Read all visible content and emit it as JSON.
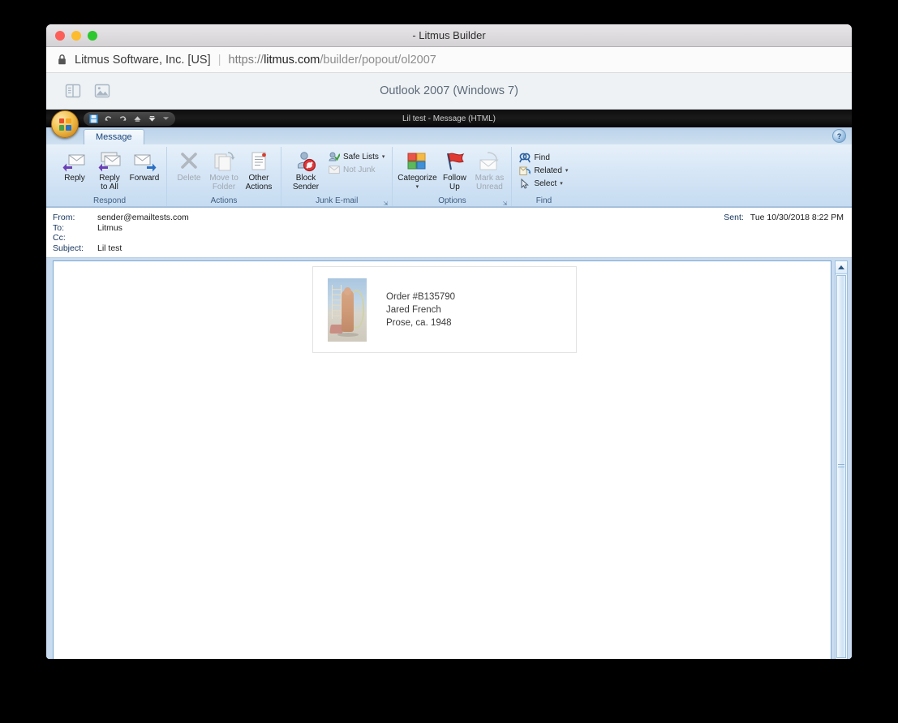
{
  "browser": {
    "title": "- Litmus Builder",
    "traffic_lights": [
      "close",
      "minimize",
      "maximize"
    ],
    "security": {
      "icon": "lock-icon",
      "owner": "Litmus Software, Inc. [US]",
      "separator": "|"
    },
    "url": {
      "scheme": "https://",
      "host": "litmus.com",
      "path": "/builder/popout/ol2007"
    }
  },
  "litmus_toolbar": {
    "icons": [
      "split-pane-icon",
      "image-icon"
    ],
    "client_name": "Outlook 2007 (Windows 7)"
  },
  "outlook": {
    "window_title": "Lil test  -  Message (HTML)",
    "office_button": "Office",
    "quick_access": [
      {
        "name": "save-icon",
        "label": "Save"
      },
      {
        "name": "undo-icon",
        "label": "Undo"
      },
      {
        "name": "redo-icon",
        "label": "Redo"
      },
      {
        "name": "previous-item-icon",
        "label": "Previous Item"
      },
      {
        "name": "next-item-icon",
        "label": "Next Item"
      },
      {
        "name": "customize-qat-icon",
        "label": "Customize Quick Access Toolbar"
      }
    ],
    "tabs": [
      {
        "label": "Message",
        "active": true
      }
    ],
    "help_label": "?",
    "ribbon_groups": [
      {
        "label": "Respond",
        "dialog_launcher": false,
        "buttons": [
          {
            "label_line1": "Reply",
            "label_line2": "",
            "icon": "reply-icon",
            "disabled": false
          },
          {
            "label_line1": "Reply",
            "label_line2": "to All",
            "icon": "reply-all-icon",
            "disabled": false
          },
          {
            "label_line1": "Forward",
            "label_line2": "",
            "icon": "forward-icon",
            "disabled": false
          }
        ]
      },
      {
        "label": "Actions",
        "dialog_launcher": false,
        "buttons": [
          {
            "label_line1": "Delete",
            "label_line2": "",
            "icon": "delete-icon",
            "disabled": true
          },
          {
            "label_line1": "Move to",
            "label_line2": "Folder",
            "icon": "move-to-folder-icon",
            "disabled": true,
            "caret": true
          },
          {
            "label_line1": "Other",
            "label_line2": "Actions",
            "icon": "other-actions-icon",
            "disabled": false,
            "caret": true
          }
        ]
      },
      {
        "label": "Junk E-mail",
        "dialog_launcher": true,
        "buttons": [
          {
            "label_line1": "Block",
            "label_line2": "Sender",
            "icon": "block-sender-icon",
            "disabled": false
          }
        ],
        "small_buttons": [
          {
            "label": "Safe Lists",
            "icon": "safe-lists-icon",
            "caret": true,
            "disabled": false
          },
          {
            "label": "Not Junk",
            "icon": "not-junk-icon",
            "caret": false,
            "disabled": true
          }
        ]
      },
      {
        "label": "Options",
        "dialog_launcher": true,
        "buttons": [
          {
            "label_line1": "Categorize",
            "label_line2": "",
            "icon": "categorize-icon",
            "disabled": false,
            "caret": true
          },
          {
            "label_line1": "Follow",
            "label_line2": "Up",
            "icon": "follow-up-icon",
            "disabled": false,
            "caret": true
          },
          {
            "label_line1": "Mark as",
            "label_line2": "Unread",
            "icon": "mark-as-unread-icon",
            "disabled": true
          }
        ]
      },
      {
        "label": "Find",
        "dialog_launcher": false,
        "small_buttons": [
          {
            "label": "Find",
            "icon": "find-icon",
            "caret": false,
            "disabled": false
          },
          {
            "label": "Related",
            "icon": "related-icon",
            "caret": true,
            "disabled": false
          },
          {
            "label": "Select",
            "icon": "select-icon",
            "caret": true,
            "disabled": false
          }
        ]
      }
    ],
    "mail_header": {
      "from_label": "From:",
      "from_value": "sender@emailtests.com",
      "to_label": "To:",
      "to_value": "Litmus",
      "cc_label": "Cc:",
      "cc_value": "",
      "subject_label": "Subject:",
      "subject_value": "Lil test",
      "sent_label": "Sent:",
      "sent_value": "Tue 10/30/2018 8:22 PM"
    },
    "email_content": {
      "artwork_alt": "painting-of-standing-figure",
      "line1": "Order #B135790",
      "line2": "Jared French",
      "line3": "Prose, ca. 1948"
    },
    "scrollbar": {
      "up_arrow": "scroll-up-arrow",
      "down_arrow": "scroll-down-arrow",
      "thumb": "scroll-thumb"
    }
  },
  "colors": {
    "page_background": "#000000",
    "ribbon_blue": "#d3e4f5",
    "accent_blue": "#16427a",
    "titlebar_gray": "#d4d2d4"
  }
}
